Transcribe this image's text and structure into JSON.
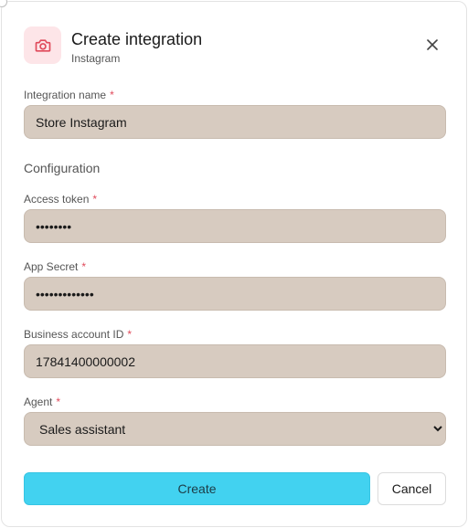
{
  "dialog": {
    "title": "Create integration",
    "subtitle": "Instagram",
    "header_icon": "camera-icon",
    "close_icon": "close-icon"
  },
  "fields": {
    "integration_name": {
      "label": "Integration name",
      "required_mark": "*",
      "value": "Store Instagram"
    },
    "configuration_label": "Configuration",
    "access_token": {
      "label": "Access token",
      "required_mark": "*",
      "value": "••••••••"
    },
    "app_secret": {
      "label": "App Secret",
      "required_mark": "*",
      "value": "•••••••••••••"
    },
    "business_account_id": {
      "label": "Business account ID",
      "required_mark": "*",
      "value": "17841400000002"
    },
    "agent": {
      "label": "Agent",
      "required_mark": "*",
      "selected": "Sales assistant"
    }
  },
  "actions": {
    "create_label": "Create",
    "cancel_label": "Cancel"
  },
  "colors": {
    "accent": "#42d2f0",
    "input_bg": "#d7cbc0",
    "required": "#e04a5b",
    "icon_bg": "#fde5e8",
    "icon_fg": "#e04a5b"
  }
}
